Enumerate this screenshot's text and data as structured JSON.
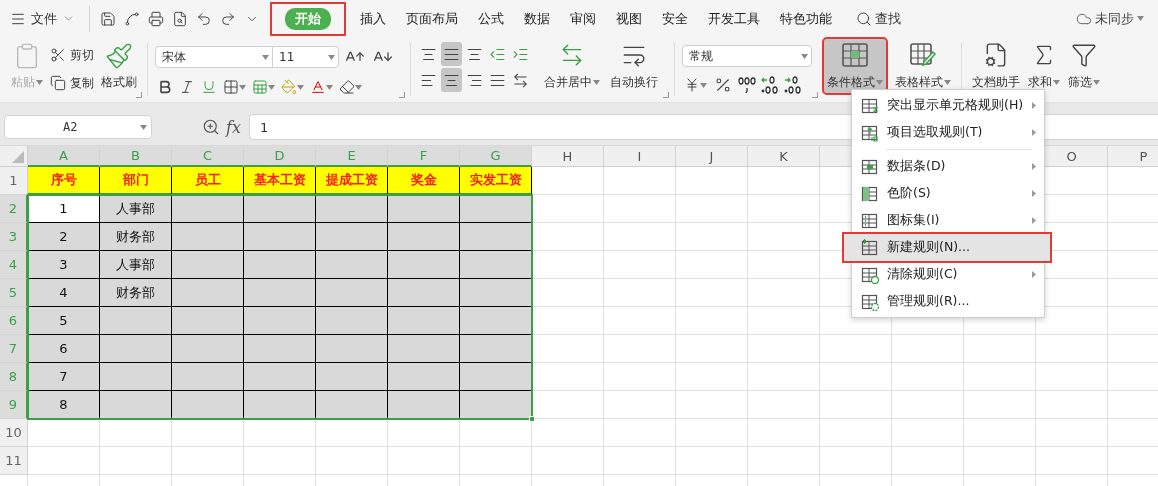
{
  "tab_bar": {
    "file_menu": "文件",
    "tabs": [
      {
        "label": "开始",
        "selected": true,
        "highlighted": true
      },
      {
        "label": "插入",
        "selected": false,
        "highlighted": false
      },
      {
        "label": "页面布局",
        "selected": false,
        "highlighted": false
      },
      {
        "label": "公式",
        "selected": false,
        "highlighted": false
      },
      {
        "label": "数据",
        "selected": false,
        "highlighted": false
      },
      {
        "label": "审阅",
        "selected": false,
        "highlighted": false
      },
      {
        "label": "视图",
        "selected": false,
        "highlighted": false
      },
      {
        "label": "安全",
        "selected": false,
        "highlighted": false
      },
      {
        "label": "开发工具",
        "selected": false,
        "highlighted": false
      },
      {
        "label": "特色功能",
        "selected": false,
        "highlighted": false
      }
    ],
    "search_label": "查找",
    "sync_status": "未同步"
  },
  "ribbon": {
    "clipboard": {
      "paste": {
        "label": "粘贴",
        "disabled": true
      },
      "cut": "剪切",
      "copy": "复制",
      "format_painter": "格式刷"
    },
    "font": {
      "family": "宋体",
      "size": "11"
    },
    "alignment": {
      "vertical": [
        {
          "kind": "top",
          "selected": false
        },
        {
          "kind": "middle",
          "selected": true
        },
        {
          "kind": "bottom",
          "selected": false
        },
        {
          "kind": "outdent",
          "selected": false
        },
        {
          "kind": "indent",
          "selected": false
        }
      ],
      "horizontal": [
        {
          "kind": "left",
          "selected": false
        },
        {
          "kind": "center",
          "selected": true
        },
        {
          "kind": "right",
          "selected": false
        },
        {
          "kind": "justify",
          "selected": false
        },
        {
          "kind": "distributed",
          "selected": false
        }
      ],
      "merge": "合并居中",
      "wrap": "自动换行"
    },
    "number": {
      "format": "常规"
    },
    "styles": [
      {
        "kind": "conditional",
        "label": "条件格式",
        "selected": true,
        "highlighted": true
      },
      {
        "kind": "table",
        "label": "表格样式",
        "selected": false,
        "highlighted": false
      }
    ],
    "tools": [
      {
        "kind": "assistant",
        "label": "文档助手",
        "dropdown": false
      },
      {
        "kind": "sum",
        "label": "求和",
        "dropdown": true
      },
      {
        "kind": "filter",
        "label": "筛选",
        "dropdown": true
      }
    ]
  },
  "formula_bar": {
    "cell_ref": "A2",
    "fx_label": "fx",
    "value": "1"
  },
  "sheet": {
    "columns": [
      {
        "label": "A",
        "selected": true
      },
      {
        "label": "B",
        "selected": true
      },
      {
        "label": "C",
        "selected": true
      },
      {
        "label": "D",
        "selected": true
      },
      {
        "label": "E",
        "selected": true
      },
      {
        "label": "F",
        "selected": true
      },
      {
        "label": "G",
        "selected": true
      },
      {
        "label": "H",
        "selected": false
      },
      {
        "label": "I",
        "selected": false
      },
      {
        "label": "J",
        "selected": false
      },
      {
        "label": "K",
        "selected": false
      }
    ],
    "columns_after_menu": [
      {
        "label": "O",
        "selected": false
      },
      {
        "label": "P",
        "selected": false
      }
    ],
    "rows": [
      {
        "label": "1",
        "kind": "header",
        "selected": false,
        "cells": [
          {
            "text": "序号",
            "active": false
          },
          {
            "text": "部门",
            "active": false
          },
          {
            "text": "员工",
            "active": false
          },
          {
            "text": "基本工资",
            "active": false
          },
          {
            "text": "提成工资",
            "active": false
          },
          {
            "text": "奖金",
            "active": false
          },
          {
            "text": "实发工资",
            "active": false
          }
        ]
      },
      {
        "label": "2",
        "kind": "data",
        "selected": true,
        "cells": [
          {
            "text": "1",
            "active": true
          },
          {
            "text": "人事部",
            "active": false
          }
        ]
      },
      {
        "label": "3",
        "kind": "data",
        "selected": true,
        "cells": [
          {
            "text": "2",
            "active": false
          },
          {
            "text": "财务部",
            "active": false
          }
        ]
      },
      {
        "label": "4",
        "kind": "data",
        "selected": true,
        "cells": [
          {
            "text": "3",
            "active": false
          },
          {
            "text": "人事部",
            "active": false
          }
        ]
      },
      {
        "label": "5",
        "kind": "data",
        "selected": true,
        "cells": [
          {
            "text": "4",
            "active": false
          },
          {
            "text": "财务部",
            "active": false
          }
        ]
      },
      {
        "label": "6",
        "kind": "data",
        "selected": true,
        "cells": [
          {
            "text": "5",
            "active": false
          }
        ]
      },
      {
        "label": "7",
        "kind": "data",
        "selected": true,
        "cells": [
          {
            "text": "6",
            "active": false
          }
        ]
      },
      {
        "label": "8",
        "kind": "data",
        "selected": true,
        "cells": [
          {
            "text": "7",
            "active": false
          }
        ]
      },
      {
        "label": "9",
        "kind": "data",
        "selected": true,
        "cells": [
          {
            "text": "8",
            "active": false
          }
        ]
      },
      {
        "label": "10",
        "kind": "blank",
        "selected": false
      },
      {
        "label": "11",
        "kind": "blank",
        "selected": false
      }
    ]
  },
  "menu": {
    "groups": [
      [
        {
          "kind": "highlight",
          "label": "突出显示单元格规则(H)",
          "submenu": true,
          "selected": false,
          "highlighted": false
        },
        {
          "kind": "top10",
          "label": "项目选取规则(T)",
          "submenu": true,
          "selected": false,
          "highlighted": false
        }
      ],
      [
        {
          "kind": "databar",
          "label": "数据条(D)",
          "submenu": true,
          "selected": false,
          "highlighted": false
        },
        {
          "kind": "colorscale",
          "label": "色阶(S)",
          "submenu": true,
          "selected": false,
          "highlighted": false
        },
        {
          "kind": "iconset",
          "label": "图标集(I)",
          "submenu": true,
          "selected": false,
          "highlighted": false
        },
        {
          "kind": "new",
          "label": "新建规则(N)...",
          "submenu": false,
          "selected": true,
          "highlighted": true
        },
        {
          "kind": "clear",
          "label": "清除规则(C)",
          "submenu": true,
          "selected": false,
          "highlighted": false
        },
        {
          "kind": "manage",
          "label": "管理规则(R)...",
          "submenu": false,
          "selected": false,
          "highlighted": false
        }
      ]
    ]
  }
}
